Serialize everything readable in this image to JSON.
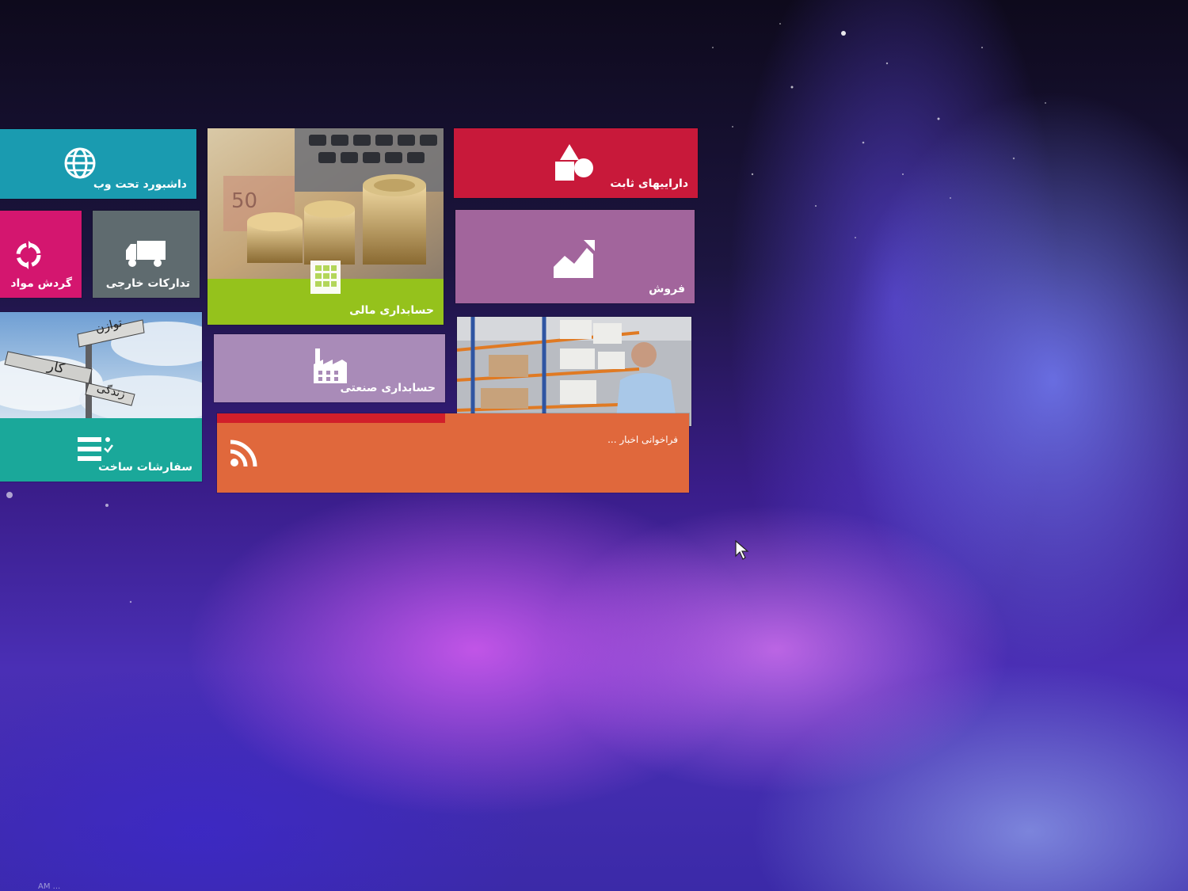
{
  "tiles": {
    "dashboard_web": {
      "label": "داشبورد تحت وب",
      "icon": "globe-icon",
      "color": "#1a9bb0"
    },
    "financial_accounting": {
      "label": "حسابداری مالی",
      "icon": "calculator-icon",
      "color": "#95c21c"
    },
    "fixed_assets": {
      "label": "داراییهای ثابت",
      "icon": "shapes-icon",
      "color": "#c8193a"
    },
    "material_flow": {
      "label": "گردش مواد",
      "icon": "refresh-cycle-icon",
      "color": "#d4166f"
    },
    "foreign_procurement": {
      "label": "تدارکات خارجی",
      "icon": "truck-icon",
      "color": "#5f6b6f"
    },
    "sales": {
      "label": "فروش",
      "icon": "trend-chart-icon",
      "color": "#a2659c"
    },
    "industrial_accounting": {
      "label": "حسابداری صنعتی",
      "icon": "factory-icon",
      "color": "#a98bb8"
    },
    "build_orders": {
      "label": "سفارشات ساخت",
      "icon": "checklist-icon",
      "color": "#1aa89a",
      "sign_words": [
        "توازن",
        "کار",
        "زندگی"
      ]
    },
    "news_feed": {
      "label": "فراخوانی اخبار ...",
      "icon": "rss-icon",
      "color": "#e0683c"
    }
  },
  "taskbar": {
    "clock_text": "AM ..."
  }
}
